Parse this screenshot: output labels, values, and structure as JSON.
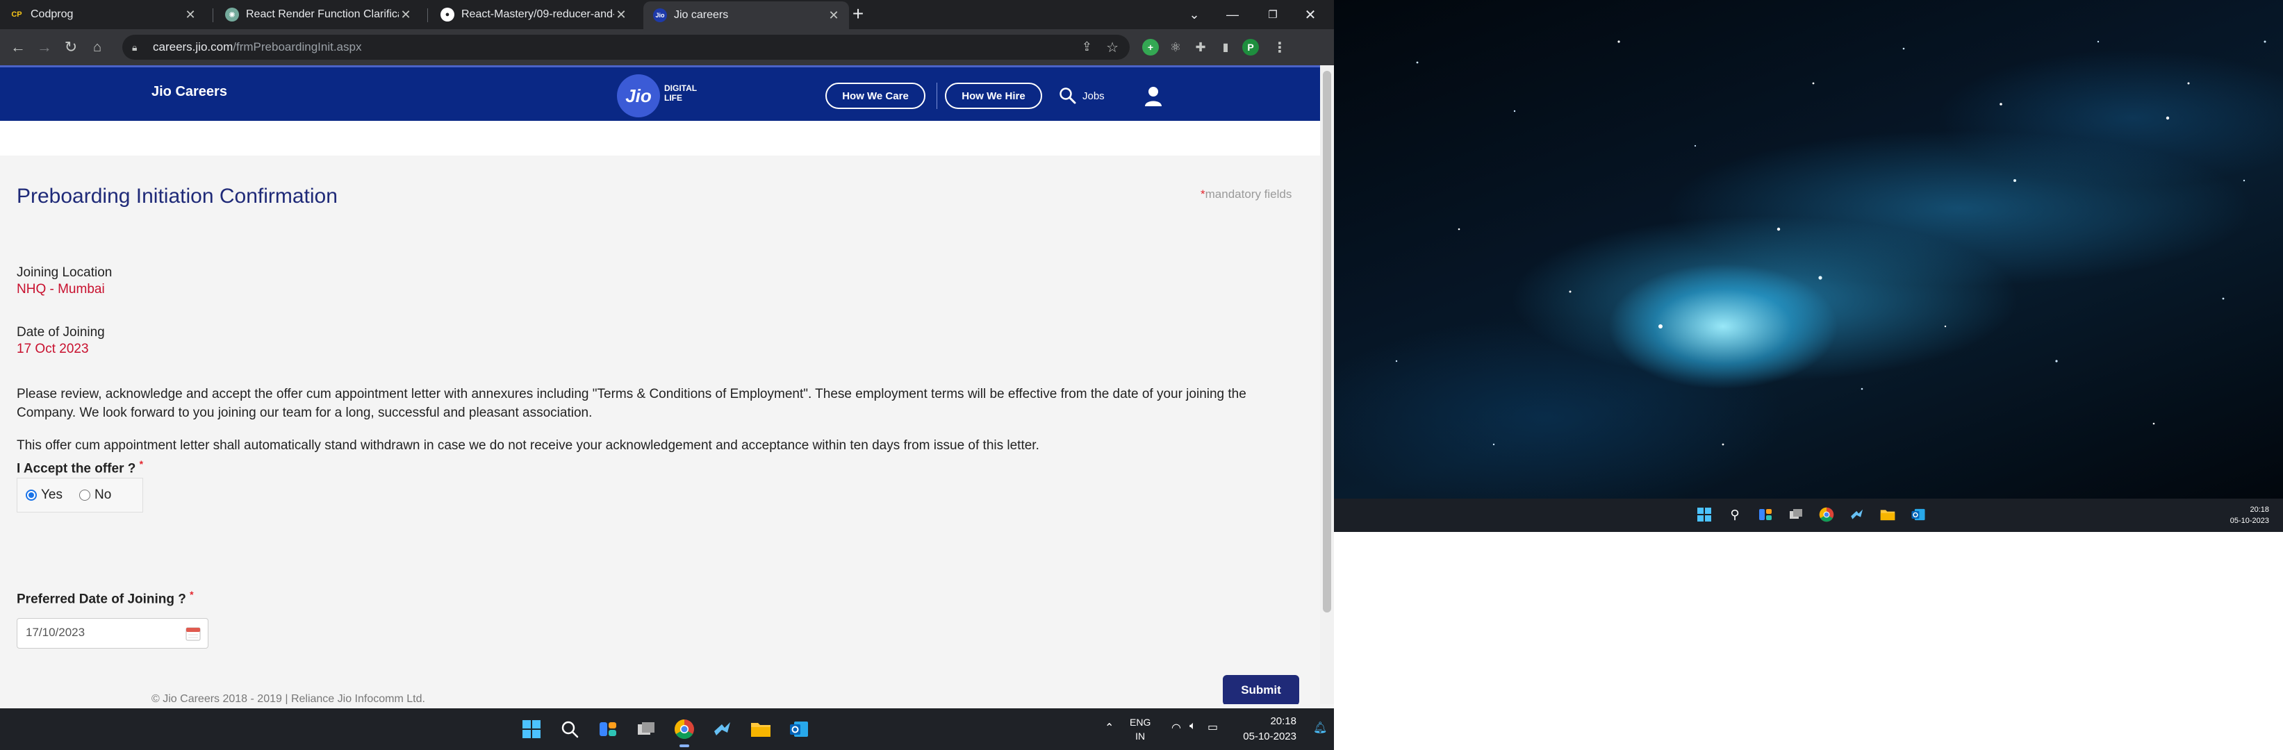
{
  "browser": {
    "tabs": [
      {
        "title": "Codprog",
        "favicon": "CP"
      },
      {
        "title": "React Render Function Clarificati",
        "favicon": "chatgpt-icon"
      },
      {
        "title": "React-Mastery/09-reducer-and-",
        "favicon": "github-icon"
      },
      {
        "title": "Jio careers",
        "favicon": "jio-icon"
      }
    ],
    "url_host": "careers.jio.com",
    "url_path": "/frmPreboardingInit.aspx",
    "profile_initial": "P"
  },
  "site": {
    "brand": "Jio Careers",
    "logo_text": "Jio",
    "logo_tagline_1": "DIGITAL",
    "logo_tagline_2": "LIFE",
    "nav_how_we_care": "How We Care",
    "nav_how_we_hire": "How We Hire",
    "nav_jobs": "Jobs",
    "colors": {
      "header": "#0a2885",
      "title": "#1f2a78",
      "accent_red": "#c8102e"
    }
  },
  "form": {
    "title": "Preboarding Initiation Confirmation",
    "mandatory_star": "*",
    "mandatory_text": "mandatory fields",
    "joining_location_label": "Joining Location",
    "joining_location_value": "NHQ - Mumbai",
    "date_of_joining_label": "Date of Joining",
    "date_of_joining_value": "17 Oct 2023",
    "paragraph_1": "Please review, acknowledge and accept the offer cum appointment letter with annexures including \"Terms & Conditions of Employment\". These employment terms will be effective from the date of your joining the Company. We look forward to you joining our team for a long, successful and pleasant association.",
    "paragraph_2": "This offer cum appointment letter shall automatically stand withdrawn in case we do not receive your acknowledgement and acceptance within ten days from issue of this letter.",
    "accept_label": "I Accept the offer ?",
    "accept_yes": "Yes",
    "accept_no": "No",
    "accept_selected": "Yes",
    "preferred_date_label": "Preferred Date of Joining ?",
    "preferred_date_value": "17/10/2023",
    "submit_label": "Submit"
  },
  "footer": {
    "text": "© Jio Careers 2018 - 2019 | Reliance Jio Infocomm Ltd."
  },
  "taskbar": {
    "lang_1": "ENG",
    "lang_2": "IN",
    "time": "20:18",
    "date": "05-10-2023"
  },
  "second_monitor": {
    "time": "20:18",
    "date": "05-10-2023"
  }
}
